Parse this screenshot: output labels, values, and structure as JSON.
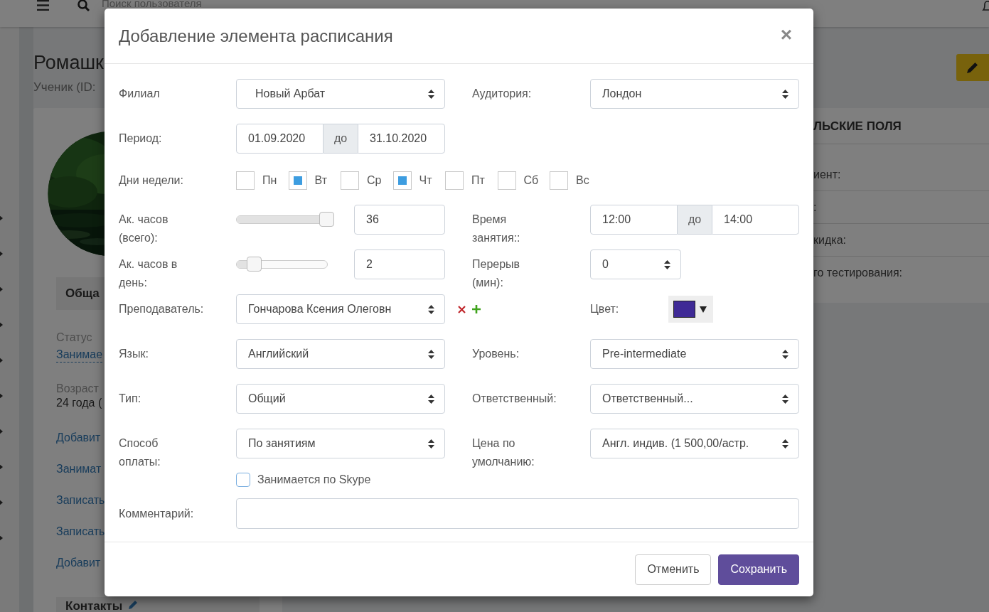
{
  "page": {
    "search_placeholder": "Поиск пользователя",
    "title": "Ромашк",
    "subtitle": "Ученик (ID:",
    "section": "Обща",
    "status_label": "Статус",
    "status_value": "Занимае",
    "age_label": "Возраст",
    "age_value": "24 года (",
    "links": [
      "Добавит",
      "Занимат",
      "Записать",
      "Записать",
      "Добавит"
    ],
    "contacts": "Контакты",
    "custom_fields": {
      "header": "ЛЬСКИЕ ПОЛЯ",
      "rows": [
        "иент:",
        ":",
        "кидка:",
        "го тестирования:"
      ]
    }
  },
  "dialog": {
    "title": "Добавление элемента расписания",
    "close": "×",
    "branch": {
      "label": "Филиал",
      "value": "Новый Арбат"
    },
    "room": {
      "label": "Аудитория:",
      "value": "Лондон"
    },
    "period": {
      "label": "Период:",
      "from": "01.09.2020",
      "separator": "до",
      "to": "31.10.2020"
    },
    "weekdays": {
      "label": "Дни недели:",
      "days": [
        {
          "label": "Пн",
          "checked": false
        },
        {
          "label": "Вт",
          "checked": true
        },
        {
          "label": "Ср",
          "checked": false
        },
        {
          "label": "Чт",
          "checked": true
        },
        {
          "label": "Пт",
          "checked": false
        },
        {
          "label": "Сб",
          "checked": false
        },
        {
          "label": "Вс",
          "checked": false
        }
      ]
    },
    "total_hours": {
      "label": "Ак. часов (всего):",
      "level": 1,
      "value": "36"
    },
    "lesson_time": {
      "label": "Время занятия::",
      "from": "12:00",
      "separator": "до",
      "to": "14:00"
    },
    "hours_per_day": {
      "label": "Ак. часов в день:",
      "level": 0.14,
      "value": "2"
    },
    "break": {
      "label": "Перерыв (мин):",
      "value": "0"
    },
    "teacher": {
      "label": "Преподаватель:",
      "value": "Гончарова Ксения Олеговн"
    },
    "color": {
      "label": "Цвет:",
      "color": "#3f2a96"
    },
    "language": {
      "label": "Язык:",
      "value": "Английский"
    },
    "level": {
      "label": "Уровень:",
      "value": "Pre-intermediate"
    },
    "type": {
      "label": "Тип:",
      "value": "Общий"
    },
    "responsible": {
      "label": "Ответственный:",
      "value": "Ответственный..."
    },
    "payment": {
      "label": "Способ оплаты:",
      "value": "По занятиям"
    },
    "default_price": {
      "label": "Цена по умолчанию:",
      "value": "Англ. индив. (1 500,00/астр."
    },
    "skype": {
      "label": "Занимается по Skype",
      "checked": false
    },
    "comment": {
      "label": "Комментарий:"
    },
    "buttons": [
      {
        "label": "Отменить",
        "kind": "secondary"
      },
      {
        "label": "Сохранить",
        "kind": "primary"
      }
    ]
  }
}
